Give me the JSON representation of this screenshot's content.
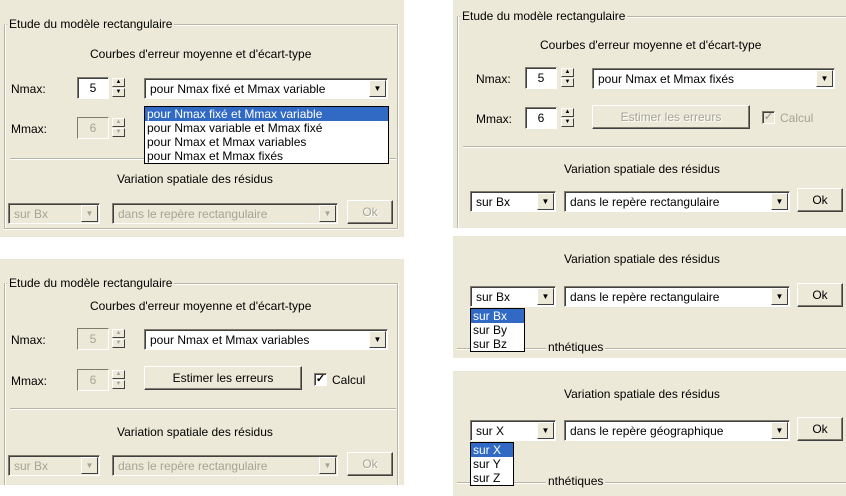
{
  "rect": {
    "group_title": "Etude du modèle rectangulaire",
    "curves_title": "Courbes d'erreur moyenne et d'écart-type",
    "nmax_label": "Nmax:",
    "mmax_label": "Mmax:",
    "estimate_button": "Estimer les erreurs",
    "calc_label": "Calcul"
  },
  "residus": {
    "title": "Variation spatiale des résidus",
    "ok": "Ok",
    "synth_title_partial": "nthétiques"
  },
  "panel1": {
    "nmax": "5",
    "mmax": "6",
    "combo": "pour Nmax fixé et Mmax variable",
    "options": [
      "pour Nmax fixé et Mmax variable",
      "pour Nmax variable et Mmax fixé",
      "pour Nmax et Mmax variables",
      "pour Nmax et Mmax fixés"
    ],
    "comp": "sur Bx",
    "frame": "dans le repère rectangulaire"
  },
  "panel2": {
    "nmax": "5",
    "mmax": "6",
    "combo": "pour Nmax et Mmax variables",
    "comp": "sur Bx",
    "frame": "dans le repère rectangulaire"
  },
  "panel3": {
    "nmax": "5",
    "mmax": "6",
    "combo": "pour Nmax et Mmax fixés",
    "comp": "sur Bx",
    "frame": "dans le repère rectangulaire"
  },
  "panel4": {
    "comp": "sur Bx",
    "frame": "dans le repère rectangulaire",
    "options": [
      "sur Bx",
      "sur By",
      "sur Bz"
    ]
  },
  "panel5": {
    "comp": "sur X",
    "frame": "dans le repère géographique",
    "options": [
      "sur X",
      "sur Y",
      "sur Z"
    ]
  }
}
